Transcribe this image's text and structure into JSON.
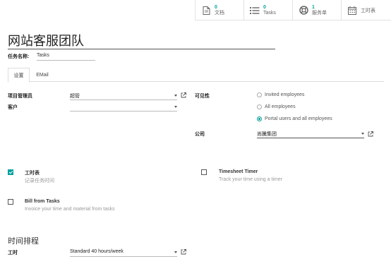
{
  "smart_buttons": [
    {
      "count": "0",
      "label": "文档",
      "icon": "file-icon"
    },
    {
      "count": "0",
      "label": "Tasks",
      "icon": "tasks-icon"
    },
    {
      "count": "1",
      "label": "服务单",
      "icon": "lifebuoy-icon"
    },
    {
      "count": "",
      "label": "工时表",
      "icon": "calendar-icon"
    }
  ],
  "project": {
    "name": "网站客服团队",
    "task_name_label": "任务名称:",
    "task_name_value": "Tasks"
  },
  "tabs": [
    {
      "label": "设置",
      "active": true
    },
    {
      "label": "EMail",
      "active": false
    }
  ],
  "settings": {
    "manager_label": "项目管理员",
    "manager_value": "超管",
    "customer_label": "客户",
    "customer_value": "",
    "visibility_label": "可见性",
    "visibility_options": [
      {
        "label": "Invited employees",
        "selected": false
      },
      {
        "label": "All employees",
        "selected": false
      },
      {
        "label": "Portal users and all employees",
        "selected": true
      }
    ],
    "company_label": "公司",
    "company_value": "尚騰集团"
  },
  "options": {
    "timesheet": {
      "title": "工时表",
      "desc": "记录任务时间",
      "checked": true
    },
    "timesheet_timer": {
      "title": "Timesheet Timer",
      "desc": "Track your time using a timer",
      "checked": false
    },
    "bill_from_tasks": {
      "title": "Bill from Tasks",
      "desc": "Invoice your time and material from tasks",
      "checked": false
    }
  },
  "scheduling": {
    "section_title": "时间排程",
    "hours_label": "工时",
    "hours_value": "Standard 40 hours/week"
  },
  "colors": {
    "accent": "#00a09d"
  }
}
